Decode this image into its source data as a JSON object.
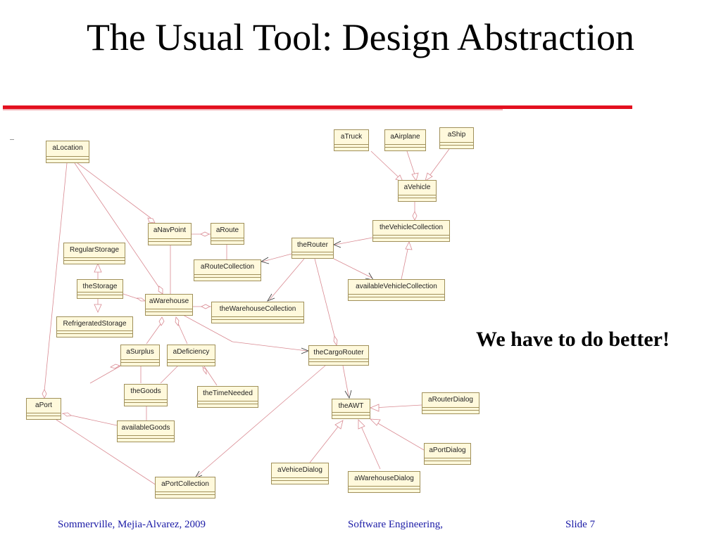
{
  "slide": {
    "title": "The Usual Tool: Design Abstraction",
    "callout": "We have to do better!",
    "footer": {
      "authors": "Sommerville, Mejia-Alvarez, 2009",
      "course": "Software Engineering,",
      "slide": "Slide 7"
    }
  },
  "diagram": {
    "nodes": [
      {
        "id": "aLocation",
        "label": "aLocation"
      },
      {
        "id": "aTruck",
        "label": "aTruck"
      },
      {
        "id": "aAirplane",
        "label": "aAirplane"
      },
      {
        "id": "aShip",
        "label": "aShip"
      },
      {
        "id": "aVehicle",
        "label": "aVehicle"
      },
      {
        "id": "theVehicleCollection",
        "label": "theVehicleCollection"
      },
      {
        "id": "aNavPoint",
        "label": "aNavPoint"
      },
      {
        "id": "aRoute",
        "label": "aRoute"
      },
      {
        "id": "theRouter",
        "label": "theRouter"
      },
      {
        "id": "RegularStorage",
        "label": "RegularStorage"
      },
      {
        "id": "aRouteCollection",
        "label": "aRouteCollection"
      },
      {
        "id": "availableVehicleCollection",
        "label": "availableVehicleCollection"
      },
      {
        "id": "theStorage",
        "label": "theStorage"
      },
      {
        "id": "aWarehouse",
        "label": "aWarehouse"
      },
      {
        "id": "theWarehouseCollection",
        "label": "theWarehouseCollection"
      },
      {
        "id": "RefrigeratedStorage",
        "label": "RefrigeratedStorage"
      },
      {
        "id": "aSurplus",
        "label": "aSurplus"
      },
      {
        "id": "aDeficiency",
        "label": "aDeficiency"
      },
      {
        "id": "theCargoRouter",
        "label": "theCargoRouter"
      },
      {
        "id": "theGoods",
        "label": "theGoods"
      },
      {
        "id": "theTimeNeeded",
        "label": "theTimeNeeded"
      },
      {
        "id": "aPort",
        "label": "aPort"
      },
      {
        "id": "theAWT",
        "label": "theAWT"
      },
      {
        "id": "aRouterDialog",
        "label": "aRouterDialog"
      },
      {
        "id": "availableGoods",
        "label": "availableGoods"
      },
      {
        "id": "aPortDialog",
        "label": "aPortDialog"
      },
      {
        "id": "aVehiceDialog",
        "label": "aVehiceDialog"
      },
      {
        "id": "aWarehouseDialog",
        "label": "aWarehouseDialog"
      },
      {
        "id": "aPortCollection",
        "label": "aPortCollection"
      }
    ]
  }
}
